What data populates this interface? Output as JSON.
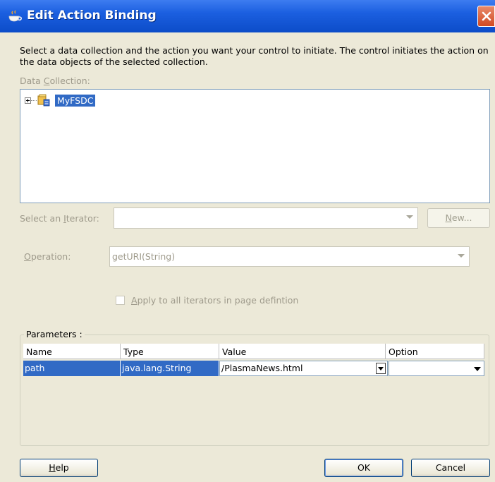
{
  "window": {
    "title": "Edit Action Binding"
  },
  "description": "Select a data collection and the action you want your control to initiate. The control initiates the action on the data objects of the selected collection.",
  "data_collection": {
    "label_pre": "Data ",
    "label_accel": "C",
    "label_post": "ollection:",
    "items": [
      {
        "label": "MyFSDC"
      }
    ]
  },
  "iterator": {
    "label_pre": "Select an ",
    "label_accel": "I",
    "label_post": "terator:",
    "value": "",
    "new_button_accel": "N",
    "new_button_rest": "ew..."
  },
  "operation": {
    "label_accel": "O",
    "label_post": "peration:",
    "value": "getURI(String)"
  },
  "apply_checkbox": {
    "label_accel": "A",
    "label_post": "pply to all iterators in page defintion"
  },
  "parameters": {
    "title": "Parameters :",
    "columns": [
      "Name",
      "Type",
      "Value",
      "Option"
    ],
    "rows": [
      {
        "name": "path",
        "type": "java.lang.String",
        "value": "/PlasmaNews.html",
        "option": ""
      }
    ]
  },
  "buttons": {
    "help_accel": "H",
    "help_rest": "elp",
    "ok": "OK",
    "cancel": "Cancel"
  },
  "colors": {
    "titlebar": "#0c4cc8",
    "selection": "#316ac5",
    "dialog_bg": "#ece9d8"
  }
}
